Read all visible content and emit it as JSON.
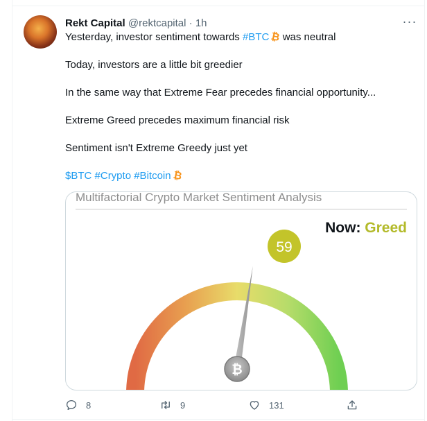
{
  "tweet": {
    "author_name": "Rekt Capital",
    "handle": "@rektcapital",
    "separator": "·",
    "time": "1h",
    "more_label": "···",
    "line1_before": "Yesterday, investor sentiment towards ",
    "line1_hashtag": "#BTC",
    "line1_after": " was neutral",
    "line2": "Today, investors are a little bit greedier",
    "line3": "In the same way that Extreme Fear precedes financial opportunity...",
    "line4": "Extreme Greed precedes maximum financial risk",
    "line5": "Sentiment isn't Extreme Greedy just yet",
    "tags": [
      "$BTC",
      "#Crypto",
      "#Bitcoin"
    ],
    "emoji_glyph": "₿"
  },
  "card": {
    "title": "Multifactorial Crypto Market Sentiment Analysis",
    "now_label": "Now:",
    "now_value": "Greed",
    "score": "59",
    "score_value": 59,
    "center_glyph": "₿",
    "colors": {
      "greed": "#b3ba2a",
      "fear": "#e06a44",
      "neutral": "#e8dc6a",
      "extreme_greed": "#7bd15a",
      "needle": "#a8a8a8"
    }
  },
  "actions": {
    "reply_icon": "reply-icon",
    "reply_count": "8",
    "retweet_icon": "retweet-icon",
    "retweet_count": "9",
    "like_icon": "heart-icon",
    "like_count": "131",
    "share_icon": "share-icon"
  }
}
